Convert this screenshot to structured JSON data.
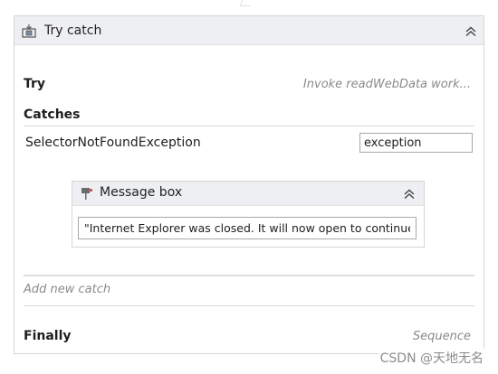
{
  "try_catch": {
    "title": "Try catch",
    "icon": "try-catch-icon",
    "try_label": "Try",
    "try_value": "Invoke readWebData work...",
    "catches_label": "Catches",
    "catch": {
      "exception_type": "SelectorNotFoundException",
      "exception_variable": "exception",
      "message_box": {
        "title": "Message box",
        "icon": "message-box-icon",
        "text": "\"Internet Explorer was closed. It will now open to continue"
      }
    },
    "add_catch_label": "Add new catch",
    "finally_label": "Finally",
    "finally_value": "Sequence"
  },
  "watermark": "CSDN @天地无名",
  "colors": {
    "header_bg": "#eeeff2",
    "border": "#d6d6d6",
    "muted_text": "#8a8a8a"
  }
}
